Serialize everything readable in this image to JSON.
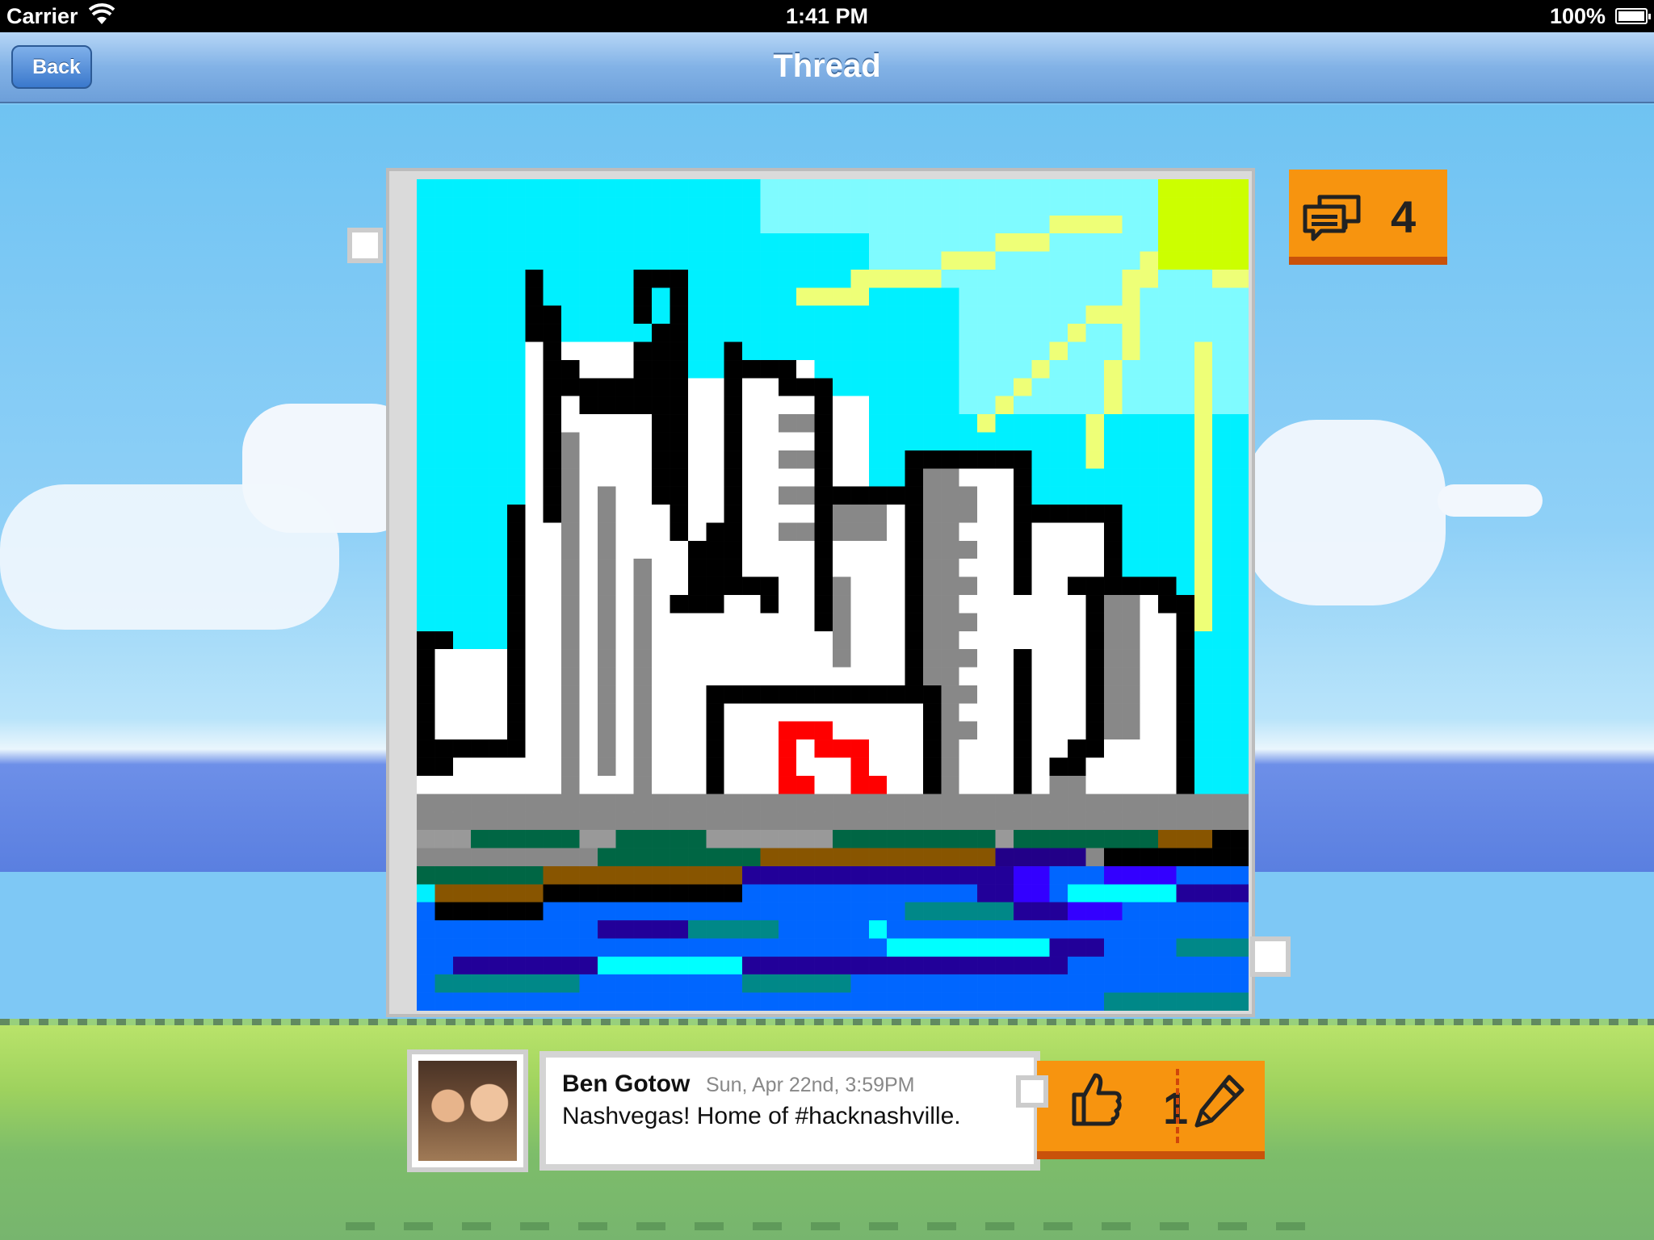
{
  "status_bar": {
    "carrier": "Carrier",
    "time": "1:41 PM",
    "battery": "100%"
  },
  "nav": {
    "title": "Thread",
    "back_label": "Back"
  },
  "thread": {
    "comment_count": "4"
  },
  "post": {
    "author": "Ben Gotow",
    "date": "Sun, Apr 22nd, 3:59PM",
    "text": "Nashvegas! Home of #hacknashville.",
    "like_count": "1"
  },
  "colors": {
    "accent_orange": "#f7940f",
    "accent_shadow": "#c9520a",
    "nav_blue": "#82b2e6"
  },
  "icons": [
    "wifi-icon",
    "battery-icon",
    "back-chevron-icon",
    "comments-icon",
    "thumbs-up-icon",
    "pencil-icon"
  ]
}
